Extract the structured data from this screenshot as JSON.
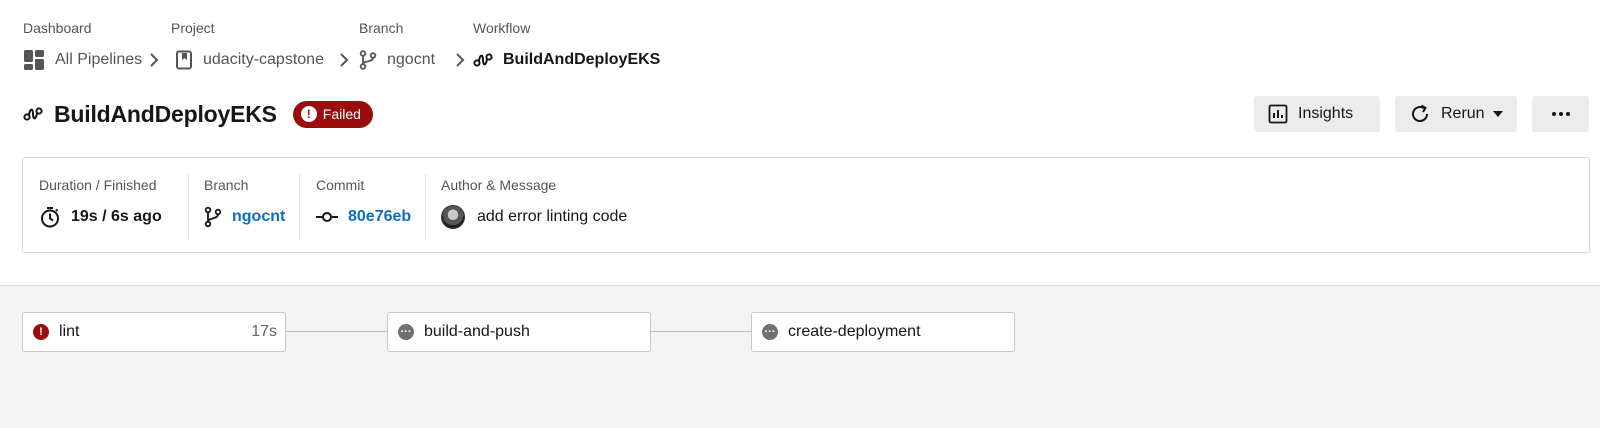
{
  "breadcrumb": [
    {
      "label": "Dashboard",
      "value": "All Pipelines"
    },
    {
      "label": "Project",
      "value": "udacity-capstone"
    },
    {
      "label": "Branch",
      "value": "ngocnt"
    },
    {
      "label": "Workflow",
      "value": "BuildAndDeployEKS"
    }
  ],
  "header": {
    "title": "BuildAndDeployEKS",
    "status": "Failed",
    "status_color": "#9b0d0d",
    "insights_label": "Insights",
    "rerun_label": "Rerun"
  },
  "info": {
    "duration": {
      "label": "Duration / Finished",
      "value": "19s / 6s ago"
    },
    "branch": {
      "label": "Branch",
      "value": "ngocnt"
    },
    "commit": {
      "label": "Commit",
      "value": "80e76eb"
    },
    "author": {
      "label": "Author & Message",
      "message": "add error linting code"
    },
    "link_color": "#0d6fc2"
  },
  "jobs": [
    {
      "name": "lint",
      "status": "failed",
      "duration": "17s"
    },
    {
      "name": "build-and-push",
      "status": "not-run",
      "duration": ""
    },
    {
      "name": "create-deployment",
      "status": "not-run",
      "duration": ""
    }
  ],
  "icons": {
    "dashboard": "dashboard-icon",
    "project": "bookmark-icon",
    "branch": "git-branch-icon",
    "workflow": "workflow-icon",
    "insights": "bar-chart-icon",
    "rerun": "refresh-icon",
    "more": "more-horizontal-icon",
    "timer": "stopwatch-icon",
    "commit": "git-commit-icon"
  }
}
